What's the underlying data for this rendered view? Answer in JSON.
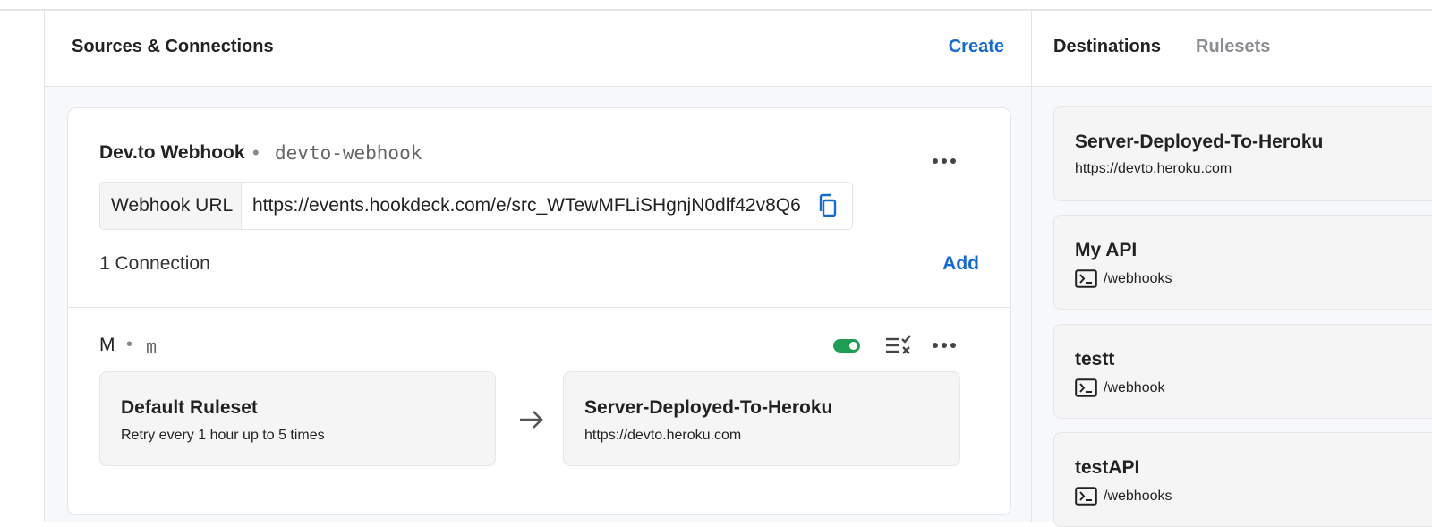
{
  "sources_panel": {
    "title": "Sources & Connections",
    "create_label": "Create"
  },
  "source": {
    "name": "Dev.to Webhook",
    "separator": "•",
    "slug": "devto-webhook",
    "url_label": "Webhook URL",
    "url_value": "https://events.hookdeck.com/e/src_WTewMFLiSHgnjN0dlf42v8Q6",
    "connection_count": "1 Connection",
    "add_label": "Add"
  },
  "connection": {
    "name": "M",
    "separator": "•",
    "slug": "m",
    "enabled": true,
    "ruleset": {
      "title": "Default Ruleset",
      "subtitle": "Retry every 1 hour up to 5 times"
    },
    "destination": {
      "title": "Server-Deployed-To-Heroku",
      "subtitle": "https://devto.heroku.com"
    }
  },
  "right_panel": {
    "tabs": [
      {
        "label": "Destinations",
        "active": true
      },
      {
        "label": "Rulesets",
        "active": false
      }
    ],
    "destinations": [
      {
        "title": "Server-Deployed-To-Heroku",
        "subtitle": "https://devto.heroku.com",
        "icon": "none"
      },
      {
        "title": "My API",
        "subtitle": "/webhooks",
        "icon": "terminal-icon"
      },
      {
        "title": "testt",
        "subtitle": "/webhook",
        "icon": "terminal-icon"
      },
      {
        "title": "testAPI",
        "subtitle": "/webhooks",
        "icon": "terminal-icon"
      }
    ]
  },
  "colors": {
    "accent": "#1569d6",
    "toggle_on": "#1f9d55",
    "panel_bg": "#f7f8fb",
    "card_bg": "#f5f5f6"
  }
}
